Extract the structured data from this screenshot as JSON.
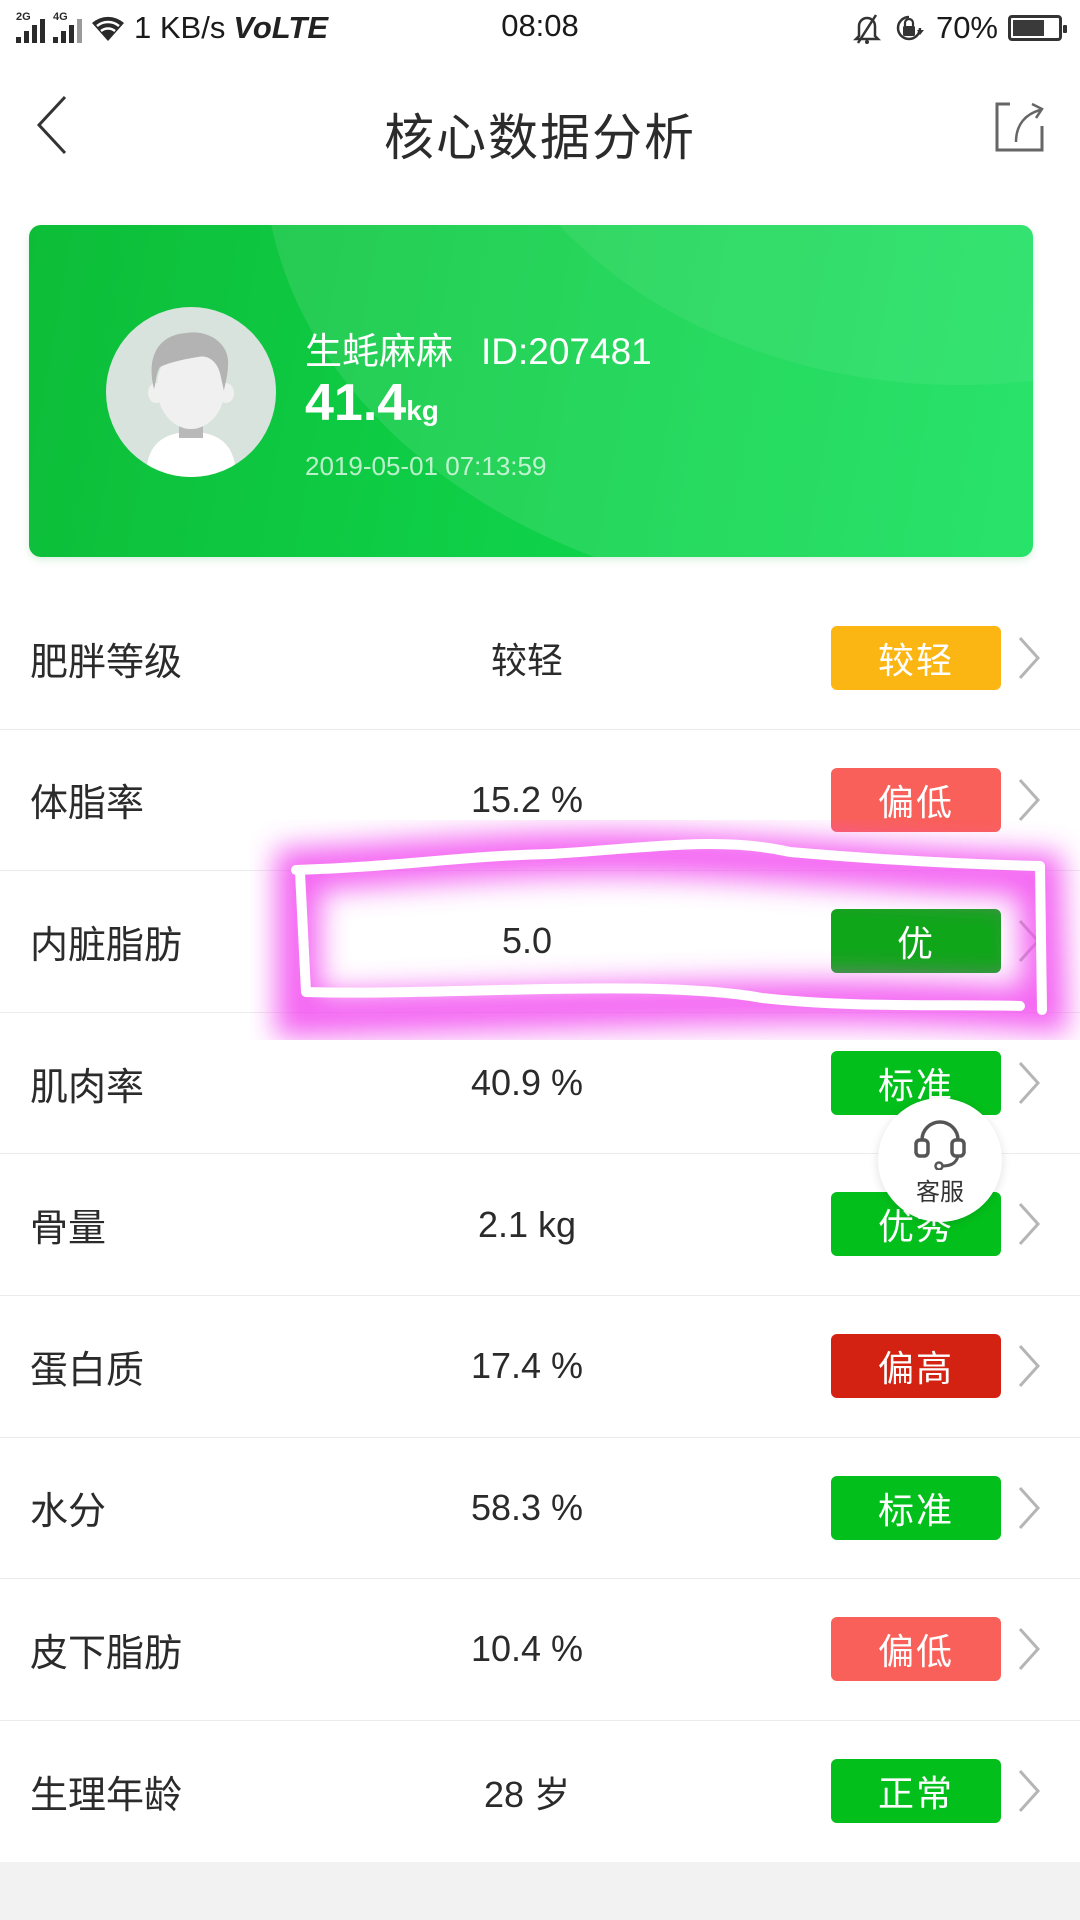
{
  "status_bar": {
    "network_2g": "2G",
    "network_4g": "4G",
    "speed": "1 KB/s",
    "volte": "VoLTE",
    "time": "08:08",
    "battery": "70%",
    "battery_level": 0.7,
    "icons": [
      "signal-icon",
      "signal-icon",
      "wifi-icon",
      "bell-muted-icon",
      "rotation-lock-icon",
      "battery-icon"
    ]
  },
  "header": {
    "title": "核心数据分析",
    "back_icon": "chevron-left-icon",
    "share_icon": "share-icon"
  },
  "profile": {
    "name": "生蚝麻麻",
    "id": "ID:207481",
    "weight": "41.4",
    "weight_unit": "kg",
    "datetime": "2019-05-01 07:13:59",
    "avatar_icon": "default-avatar-icon"
  },
  "colors": {
    "card_green": "#0fd24a",
    "yellow": "#fcb614",
    "salmon": "#f9605a",
    "green": "#03bf1b",
    "dark_green": "#10a61a",
    "red": "#d42212"
  },
  "metrics": [
    {
      "label": "肥胖等级",
      "value": "较轻",
      "status": "较轻",
      "status_color": "#fcb614"
    },
    {
      "label": "体脂率",
      "value": "15.2 %",
      "status": "偏低",
      "status_color": "#f9605a"
    },
    {
      "label": "内脏脂肪",
      "value": "5.0",
      "status": "优",
      "status_color": "#10a61a"
    },
    {
      "label": "肌肉率",
      "value": "40.9 %",
      "status": "标准",
      "status_color": "#03bf1b"
    },
    {
      "label": "骨量",
      "value": "2.1 kg",
      "status": "优秀",
      "status_color": "#03bf1b"
    },
    {
      "label": "蛋白质",
      "value": "17.4 %",
      "status": "偏高",
      "status_color": "#d42212"
    },
    {
      "label": "水分",
      "value": "58.3 %",
      "status": "标准",
      "status_color": "#03bf1b"
    },
    {
      "label": "皮下脂肪",
      "value": "10.4 %",
      "status": "偏低",
      "status_color": "#f9605a"
    },
    {
      "label": "生理年龄",
      "value": "28 岁",
      "status": "正常",
      "status_color": "#03bf1b"
    }
  ],
  "service_button": {
    "label": "客服",
    "icon": "headset-icon"
  }
}
